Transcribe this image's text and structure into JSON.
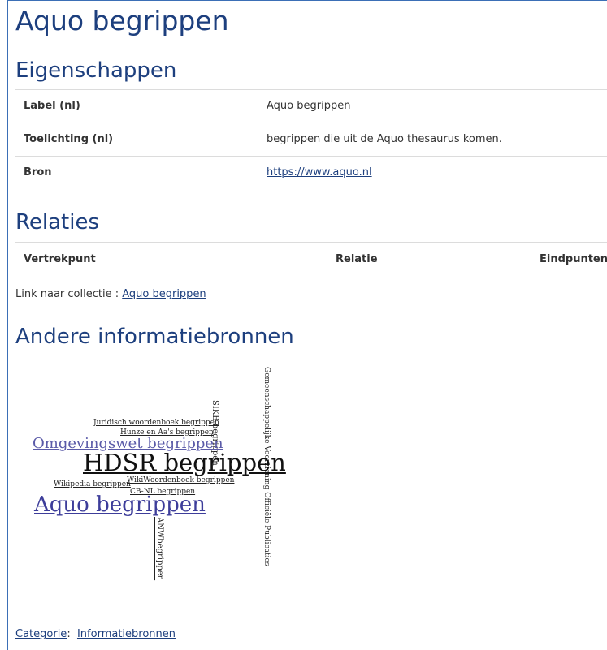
{
  "page_title": "Aquo begrippen",
  "eigenschappen": {
    "heading": "Eigenschappen",
    "rows": [
      {
        "label": "Label (nl)",
        "value": "Aquo begrippen"
      },
      {
        "label": "Toelichting (nl)",
        "value": "begrippen die uit de Aquo thesaurus komen."
      },
      {
        "label": "Bron",
        "value": "https://www.aquo.nl"
      }
    ]
  },
  "relaties": {
    "heading": "Relaties",
    "columns": [
      "Vertrekpunt",
      "Relatie",
      "Eindpunten"
    ],
    "collection_prefix": "Link naar collectie :",
    "collection_link": "Aquo begrippen"
  },
  "andere": {
    "heading": "Andere informatiebronnen",
    "cloud": [
      {
        "text": "Gemeenschappelijke Voorziening Officiële Publicaties",
        "color": "#222222"
      },
      {
        "text": "SIKB begrippen",
        "color": "#222222"
      },
      {
        "text": "Juridisch woordenboek begrippen",
        "color": "#222222"
      },
      {
        "text": "Hunze en Aa's begrippen",
        "color": "#222222"
      },
      {
        "text": "Omgevingswet begrippen",
        "color": "#5a5aa8"
      },
      {
        "text": "HDSR begrippen",
        "color": "#111111"
      },
      {
        "text": "Wikipedia begrippen",
        "color": "#222222"
      },
      {
        "text": "WikiWoordenboek begrippen",
        "color": "#222222"
      },
      {
        "text": "CB-NL begrippen",
        "color": "#222222"
      },
      {
        "text": "Aquo begrippen",
        "color": "#3d3d9a"
      },
      {
        "text": "ANWbegrippen",
        "color": "#222222"
      }
    ]
  },
  "footer": {
    "category_label": "Categorie",
    "category_sep": ":",
    "category_value": "Informatiebronnen"
  }
}
